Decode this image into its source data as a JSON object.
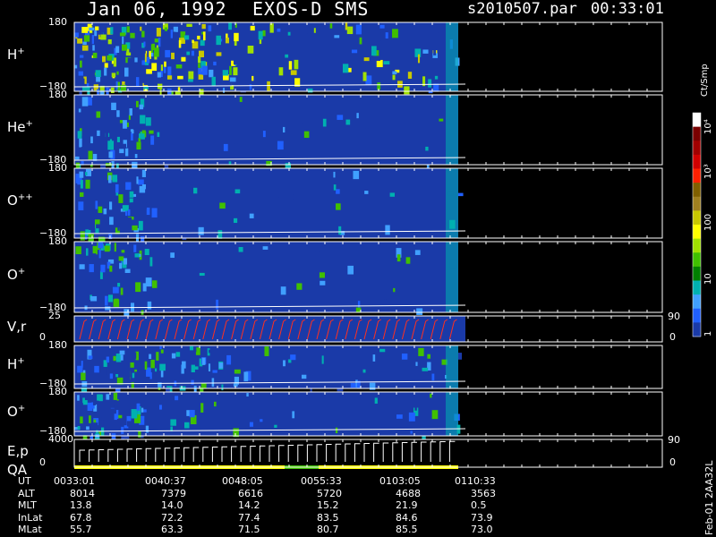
{
  "header": {
    "date": "Jan 06, 1992",
    "instrument": "EXOS-D SMS",
    "file": "s2010507.par",
    "time": "00:33:01"
  },
  "panels": [
    {
      "id": "h1",
      "label": "H",
      "sup": "+",
      "ymax": "180",
      "ymin": "−180"
    },
    {
      "id": "he",
      "label": "He",
      "sup": "+",
      "ymax": "180",
      "ymin": "−180"
    },
    {
      "id": "opp",
      "label": "O",
      "sup": "++",
      "ymax": "180",
      "ymin": "−180"
    },
    {
      "id": "o1",
      "label": "O",
      "sup": "+",
      "ymax": "180",
      "ymin": "−180"
    },
    {
      "id": "vr",
      "label": "V,r",
      "sup": "",
      "ymax": "25",
      "ymin": "0",
      "rmax": "90",
      "rmin": "0"
    },
    {
      "id": "h2",
      "label": "H",
      "sup": "+",
      "ymax": "180",
      "ymin": "−180"
    },
    {
      "id": "o2",
      "label": "O",
      "sup": "+",
      "ymax": "180",
      "ymin": "−180"
    },
    {
      "id": "ep",
      "label": "E,p",
      "label2": "QA",
      "sup": "",
      "ymax": "4000",
      "ymin": "0",
      "rmax": "90",
      "rmin": "0"
    }
  ],
  "colorbar": {
    "unit": "Ct/Smp",
    "ticks": [
      "10⁴",
      "10³",
      "100",
      "10",
      "1"
    ],
    "colors": [
      "#ffffff",
      "#7a0000",
      "#a00000",
      "#d00000",
      "#ff2000",
      "#806000",
      "#a08020",
      "#c8c800",
      "#ffff00",
      "#a0e000",
      "#40c000",
      "#008000",
      "#00b0b0",
      "#40a0ff",
      "#2060ff",
      "#1a3aa8"
    ]
  },
  "footer": {
    "rows": [
      {
        "name": "UT",
        "values": [
          "0033:01",
          "0040:37",
          "0048:05",
          "0055:33",
          "0103:05",
          "0110:33"
        ]
      },
      {
        "name": "ALT",
        "values": [
          "8014",
          "7379",
          "6616",
          "5720",
          "4688",
          "3563"
        ]
      },
      {
        "name": "MLT",
        "values": [
          "13.8",
          "14.0",
          "14.2",
          "15.2",
          "21.9",
          "0.5"
        ]
      },
      {
        "name": "InLat",
        "values": [
          "67.8",
          "72.2",
          "77.4",
          "83.5",
          "84.6",
          "73.9"
        ]
      },
      {
        "name": "MLat",
        "values": [
          "55.7",
          "63.3",
          "71.5",
          "80.7",
          "85.5",
          "73.0"
        ]
      }
    ],
    "orbit_label": "Feb-01 2AA32L"
  },
  "chart_data": {
    "type": "heatmap",
    "title": "Jan 06, 1992   EXOS-D SMS",
    "x_ticks": [
      "0033:01",
      "0040:37",
      "0048:05",
      "0055:33",
      "0103:05",
      "0110:33"
    ],
    "series": [
      {
        "name": "H+",
        "ylim": [
          -180,
          180
        ]
      },
      {
        "name": "He+",
        "ylim": [
          -180,
          180
        ]
      },
      {
        "name": "O++",
        "ylim": [
          -180,
          180
        ]
      },
      {
        "name": "O+",
        "ylim": [
          -180,
          180
        ]
      },
      {
        "name": "V,r",
        "ylim": [
          0,
          25
        ],
        "rlim": [
          0,
          90
        ]
      },
      {
        "name": "H+",
        "ylim": [
          -180,
          180
        ]
      },
      {
        "name": "O+",
        "ylim": [
          -180,
          180
        ]
      },
      {
        "name": "E,p",
        "ylim": [
          0,
          4000
        ],
        "rlim": [
          0,
          90
        ]
      }
    ],
    "colorbar_unit": "Ct/Smp",
    "colorbar_ticks": [
      "1",
      "10",
      "100",
      "10³",
      "10⁴"
    ]
  }
}
